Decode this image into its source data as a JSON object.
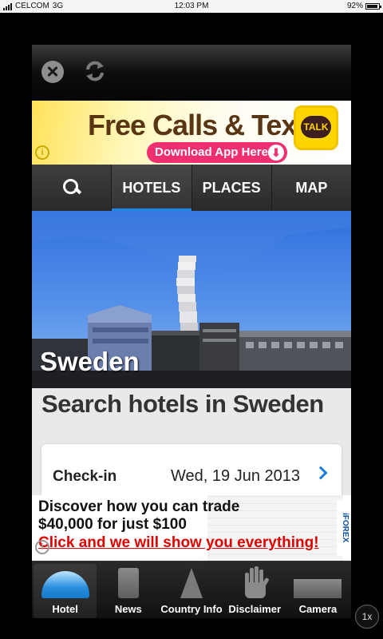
{
  "status_bar": {
    "carrier": "CELCOM",
    "network": "3G",
    "time": "12:03 PM",
    "battery": "92%",
    "battery_level": 0.92
  },
  "top_bar": {
    "close_icon": "close-icon",
    "refresh_icon": "refresh-icon"
  },
  "top_ad": {
    "headline": "Free Calls & Text",
    "cta": "Download App Here",
    "logo_text": "TALK",
    "info_glyph": "i"
  },
  "tabs": [
    {
      "label": "",
      "icon": "search-icon",
      "active": false
    },
    {
      "label": "HOTELS",
      "active": true
    },
    {
      "label": "PLACES",
      "active": false
    },
    {
      "label": "MAP",
      "active": false
    }
  ],
  "hero": {
    "title": "Sweden"
  },
  "search": {
    "title": "Search hotels in Sweden",
    "checkin_label": "Check-in",
    "checkin_value": "Wed, 19 Jun 2013"
  },
  "bottom_ad": {
    "line1": "Discover how you can trade",
    "line2": "$40,000 for just $100",
    "line3": "Click and we will show you everything!",
    "brand": "iFOREX",
    "info_glyph": "i"
  },
  "bottom_nav": [
    {
      "label": "Hotel",
      "icon": "hotel-icon",
      "active": true
    },
    {
      "label": "News",
      "icon": "news-icon",
      "active": false
    },
    {
      "label": "Country Info",
      "icon": "country-info-icon",
      "active": false
    },
    {
      "label": "Disclaimer",
      "icon": "hand-icon",
      "active": false
    },
    {
      "label": "Camera",
      "icon": "camera-icon",
      "active": false
    }
  ],
  "speed_badge": "1x",
  "colors": {
    "accent_blue": "#1e88e5",
    "ad_red": "#e00000",
    "ad_pink": "#ef2f6f",
    "talk_yellow": "#ffd500"
  }
}
